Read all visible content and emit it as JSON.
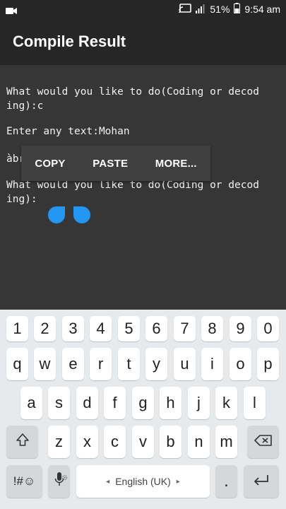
{
  "status_bar": {
    "battery": "51%",
    "time": "9:54 am",
    "icons": [
      "video-icon",
      "cast-icon",
      "signal-icon",
      "battery-icon"
    ]
  },
  "app_bar": {
    "title": "Compile Result"
  },
  "output": {
    "lines": [
      "What would you like to do(Coding or decod",
      "ing):c",
      "Enter any text:Mohan",
      "àbr",
      "What would you like to do(Coding or decod",
      "ing):"
    ]
  },
  "context_menu": {
    "copy": "COPY",
    "paste": "PASTE",
    "more": "MORE..."
  },
  "keyboard": {
    "number_row": [
      "1",
      "2",
      "3",
      "4",
      "5",
      "6",
      "7",
      "8",
      "9",
      "0"
    ],
    "row1": [
      "q",
      "w",
      "e",
      "r",
      "t",
      "y",
      "u",
      "i",
      "o",
      "p"
    ],
    "row2": [
      "a",
      "s",
      "d",
      "f",
      "g",
      "h",
      "j",
      "k",
      "l"
    ],
    "row3": [
      "z",
      "x",
      "c",
      "v",
      "b",
      "n",
      "m"
    ],
    "symbols_key": "!#☺",
    "period_key": ".",
    "language": "English (UK)",
    "icons": [
      "shift-icon",
      "backspace-icon",
      "microphone-icon",
      "settings-icon",
      "enter-icon"
    ]
  },
  "colors": {
    "accent": "#2196f3",
    "background": "#333333",
    "keyboard_bg": "#e7eaec"
  }
}
